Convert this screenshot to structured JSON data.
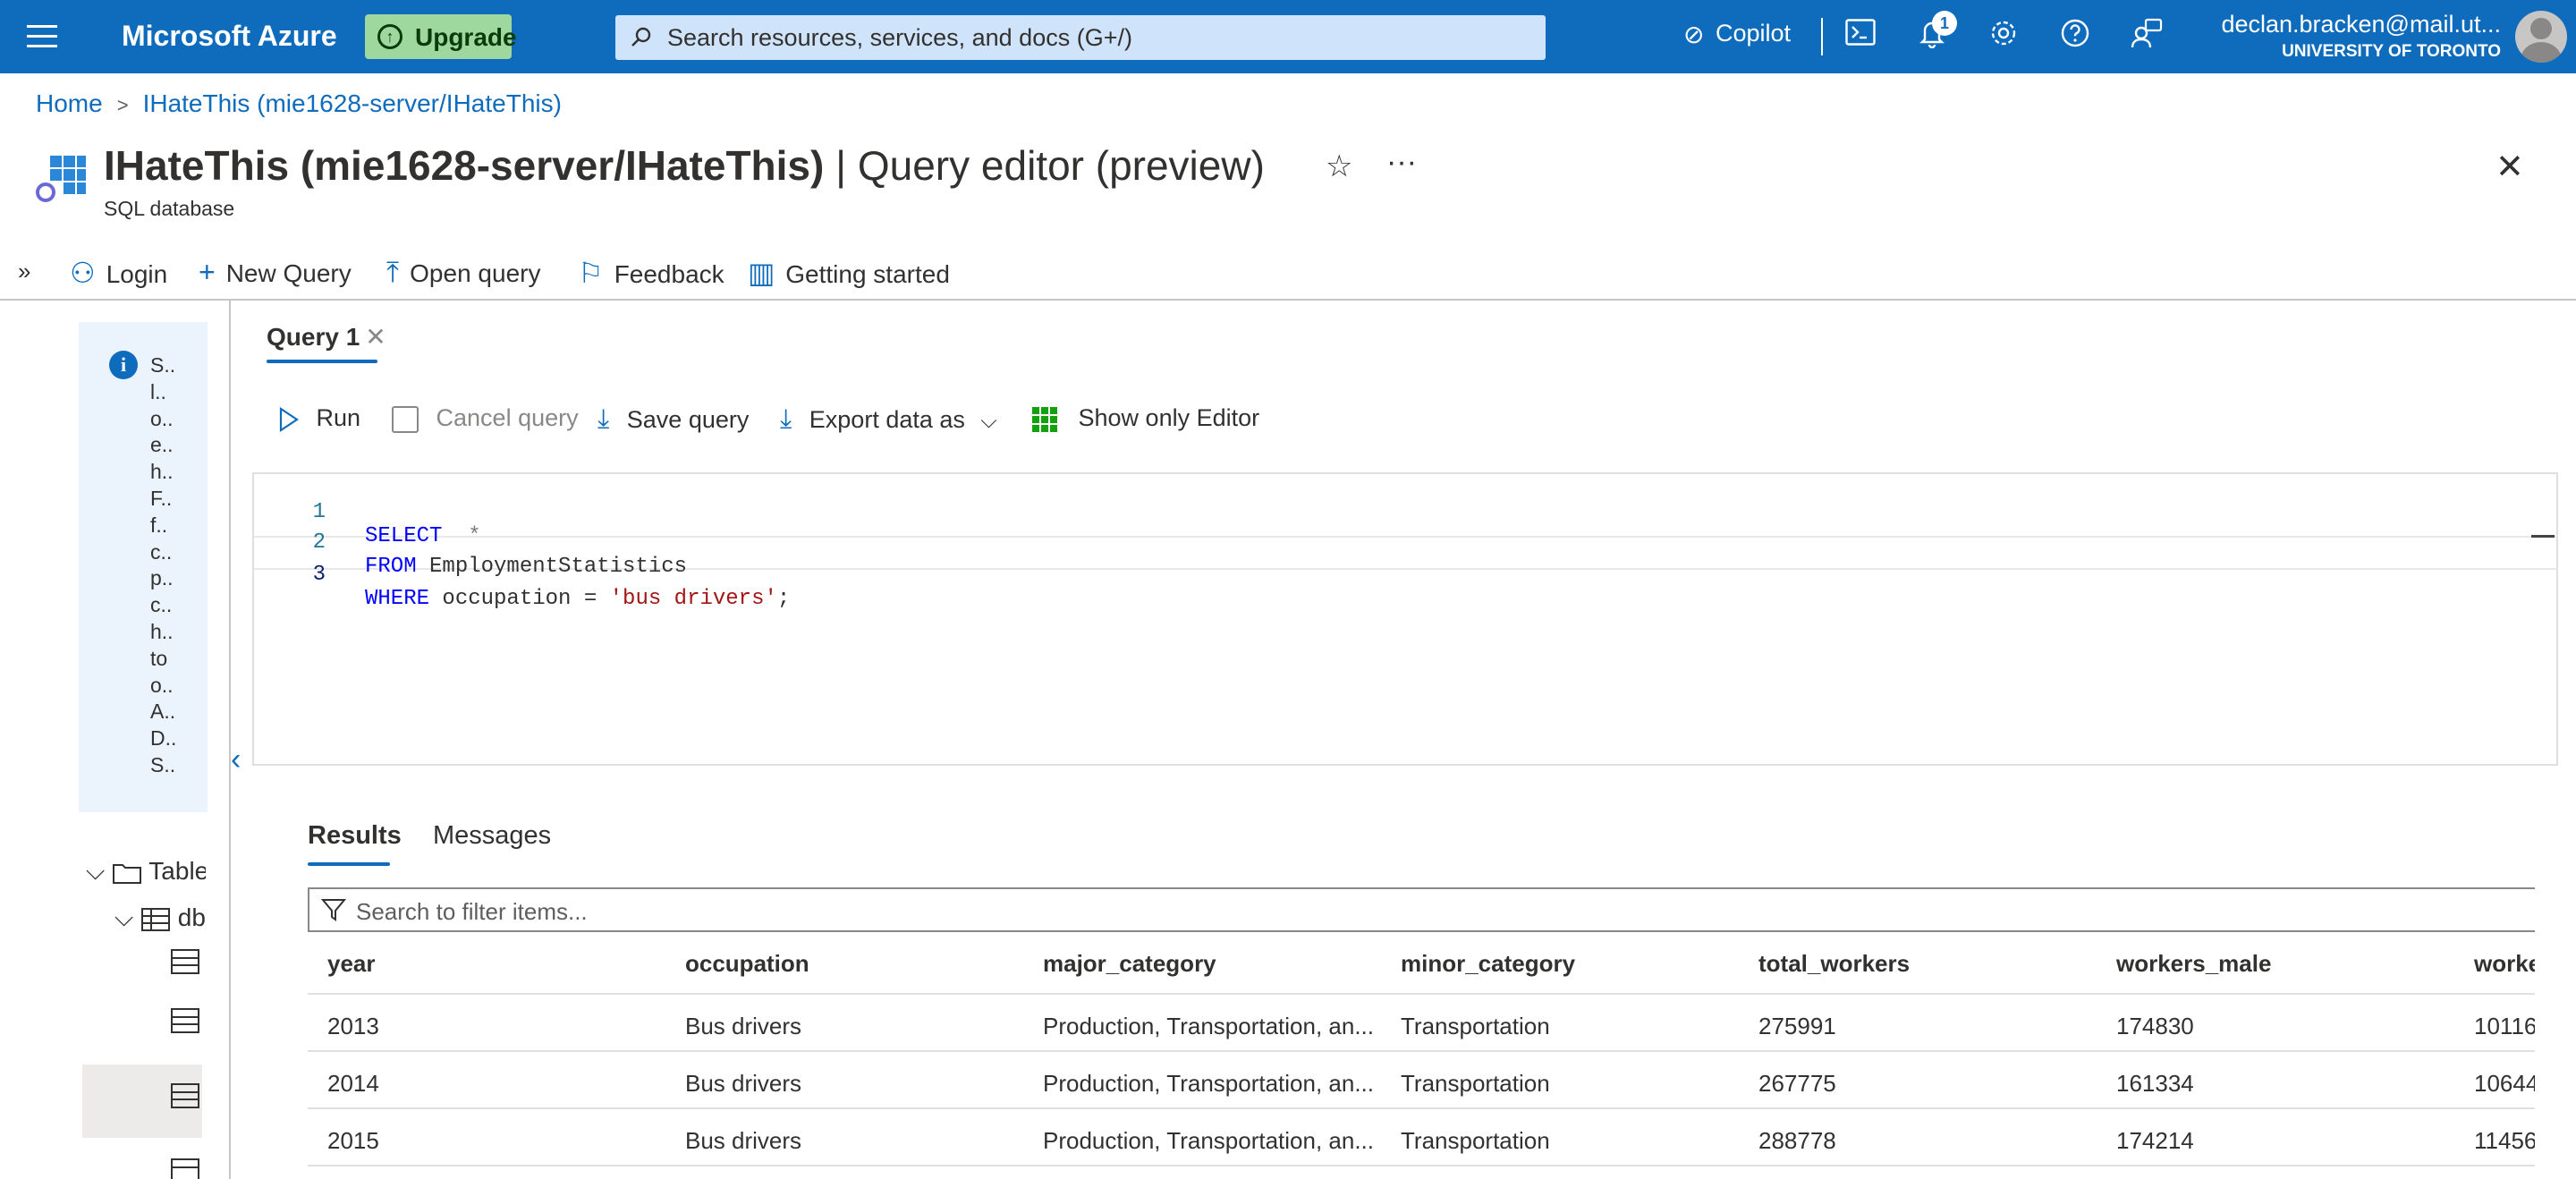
{
  "topbar": {
    "brand": "Microsoft Azure",
    "upgrade_label": "Upgrade",
    "search_placeholder": "Search resources, services, and docs (G+/)",
    "copilot_label": "Copilot",
    "notification_count": "1",
    "user_email": "declan.bracken@mail.ut...",
    "user_org": "UNIVERSITY OF TORONTO",
    "accent": "#0f6cbd"
  },
  "breadcrumb": {
    "home": "Home",
    "current": "IHateThis (mie1628-server/IHateThis)"
  },
  "header": {
    "title_main": "IHateThis (mie1628-server/IHateThis)",
    "title_suffix": " | Query editor (preview)",
    "subtitle": "SQL database"
  },
  "commandbar": {
    "login": "Login",
    "new_query": "New Query",
    "open_query": "Open query",
    "feedback": "Feedback",
    "getting_started": "Getting started"
  },
  "sidebar": {
    "info_lines": [
      "S..",
      "l..",
      "o..",
      "e..",
      "h..",
      "F..",
      "f..",
      "c..",
      "p..",
      "c..",
      "h..",
      "to",
      "o..",
      "A..",
      "D..",
      "S.."
    ],
    "tree_tables": "Tables",
    "tree_schema": "dbo"
  },
  "query_tab": {
    "label": "Query 1"
  },
  "editor_toolbar": {
    "run": "Run",
    "cancel": "Cancel query",
    "save": "Save query",
    "export": "Export data as",
    "show_only_editor": "Show only Editor"
  },
  "editor": {
    "lines": [
      {
        "num": "1",
        "kw": "SELECT",
        "rest": "  *"
      },
      {
        "num": "2",
        "kw": "FROM",
        "rest": " EmploymentStatistics"
      },
      {
        "num": "3",
        "kw": "WHERE",
        "rest": " occupation = ",
        "str": "'bus drivers'",
        "end": ";"
      }
    ]
  },
  "results_tabs": {
    "results": "Results",
    "messages": "Messages"
  },
  "filter_placeholder": "Search to filter items...",
  "results": {
    "columns": [
      "year",
      "occupation",
      "major_category",
      "minor_category",
      "total_workers",
      "workers_male",
      "worke"
    ],
    "rows": [
      [
        "2013",
        "Bus drivers",
        "Production, Transportation, an...",
        "Transportation",
        "275991",
        "174830",
        "10116"
      ],
      [
        "2014",
        "Bus drivers",
        "Production, Transportation, an...",
        "Transportation",
        "267775",
        "161334",
        "10644"
      ],
      [
        "2015",
        "Bus drivers",
        "Production, Transportation, an...",
        "Transportation",
        "288778",
        "174214",
        "11456"
      ]
    ]
  }
}
